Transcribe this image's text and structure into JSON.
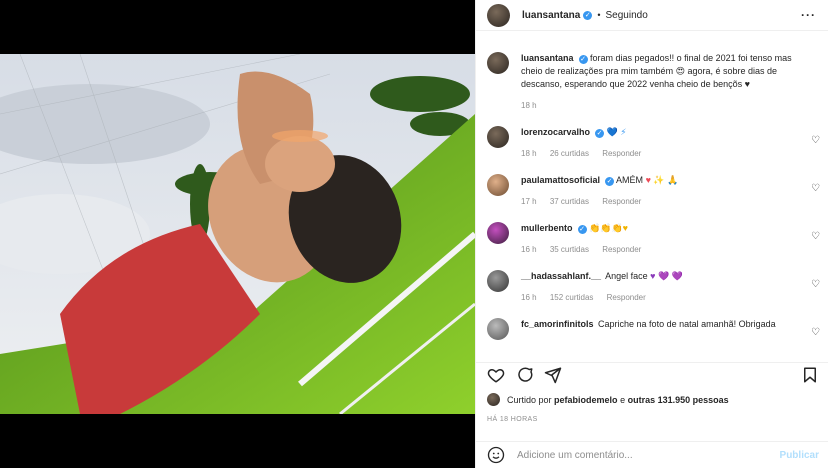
{
  "post": {
    "username": "luansantana",
    "follow_state": "Seguindo",
    "caption": "foram dias pegados!! o final de 2021 foi tenso mas cheio de realizações pra mim também 😍 agora, é sobre dias de descanso, esperando que 2022 venha cheio de bençõs ♥",
    "caption_time": "18 h"
  },
  "comments": [
    {
      "user": "lorenzocarvalho",
      "verified": true,
      "text": "",
      "emoji": "💙 ⚡",
      "time": "18 h",
      "likes": "26 curtidas",
      "reply": "Responder"
    },
    {
      "user": "paulamattosoficial",
      "verified": true,
      "text": "AMÉM",
      "emoji": "♥ ✨ 🙏",
      "time": "17 h",
      "likes": "37 curtidas",
      "reply": "Responder"
    },
    {
      "user": "mullerbento",
      "verified": true,
      "text": "",
      "emoji": "👏👏👏♥",
      "time": "16 h",
      "likes": "35 curtidas",
      "reply": "Responder"
    },
    {
      "user": "__hadassahlanf.__",
      "verified": false,
      "text": "Angel face",
      "emoji": "♥ 💜 💜",
      "time": "16 h",
      "likes": "152 curtidas",
      "reply": "Responder"
    },
    {
      "user": "fc_amorinfinitols",
      "verified": false,
      "text": "Capriche na foto de natal amanhã! Obrigada",
      "emoji": "",
      "time": "",
      "likes": "",
      "reply": ""
    }
  ],
  "likes": {
    "prefix": "Curtido por",
    "user": "pefabiodemelo",
    "suffix_pre": "e",
    "others": "outras 131.950 pessoas"
  },
  "timestamp": "HÁ 18 HORAS",
  "add_comment": {
    "placeholder": "Adicione um comentário...",
    "publish": "Publicar"
  },
  "icons": [
    "more-icon",
    "heart-icon",
    "comment-icon",
    "share-icon",
    "bookmark-icon",
    "emoji-icon",
    "verified-icon"
  ],
  "colors": {
    "verified": "#3897f0",
    "like": "#ed4956",
    "muted": "#8e8e8e",
    "publish": "#b2dffc"
  }
}
